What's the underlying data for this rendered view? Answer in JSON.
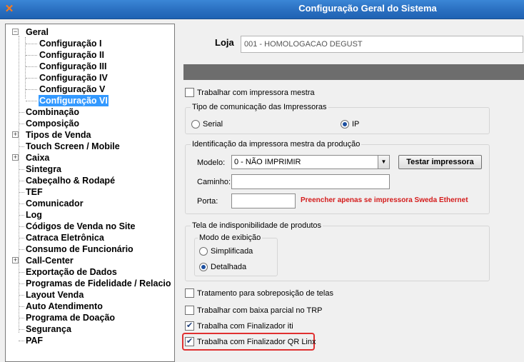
{
  "window": {
    "title": "Configuração Geral do Sistema",
    "icon": "x-logo-icon",
    "accent": "#2a6fc0"
  },
  "tree": {
    "items": [
      {
        "label": "Geral",
        "expanded": true
      },
      {
        "label": "Configuração I"
      },
      {
        "label": "Configuração II"
      },
      {
        "label": "Configuração III"
      },
      {
        "label": "Configuração IV"
      },
      {
        "label": "Configuração V"
      },
      {
        "label": "Configuração VI",
        "selected": true
      },
      {
        "label": "Combinação"
      },
      {
        "label": "Composição"
      },
      {
        "label": "Tipos de Venda",
        "expandable": true
      },
      {
        "label": "Touch Screen / Mobile"
      },
      {
        "label": "Caixa",
        "expandable": true
      },
      {
        "label": "Sintegra"
      },
      {
        "label": "Cabeçalho & Rodapé"
      },
      {
        "label": "TEF"
      },
      {
        "label": "Comunicador"
      },
      {
        "label": "Log"
      },
      {
        "label": "Códigos de Venda no Site"
      },
      {
        "label": "Catraca Eletrônica"
      },
      {
        "label": "Consumo de Funcionário"
      },
      {
        "label": "Call-Center",
        "expandable": true
      },
      {
        "label": "Exportação de Dados"
      },
      {
        "label": "Programas de Fidelidade / Relacio"
      },
      {
        "label": "Layout Venda"
      },
      {
        "label": "Auto Atendimento"
      },
      {
        "label": "Programa de Doação"
      },
      {
        "label": "Segurança"
      },
      {
        "label": "PAF"
      }
    ]
  },
  "loja": {
    "label": "Loja",
    "value": "001 - HOMOLOGACAO DEGUST"
  },
  "options": {
    "impressora_mestra": {
      "label": "Trabalhar com impressora mestra",
      "checked": false
    },
    "sobreposicao": {
      "label": "Tratamento para sobreposição de telas",
      "checked": false
    },
    "baixa_parcial": {
      "label": "Trabalhar com baixa parcial no TRP",
      "checked": false
    },
    "finalizador_iti": {
      "label": "Trabalha com Finalizador iti",
      "checked": true
    },
    "finalizador_qr": {
      "label": "Trabalha com Finalizador QR Linx",
      "checked": true
    }
  },
  "comunicacao": {
    "title": "Tipo de comunicação das Impressoras",
    "serial_label": "Serial",
    "ip_label": "IP",
    "selected": "IP"
  },
  "identificacao": {
    "title": "Identificação da impressora mestra da produção",
    "modelo_label": "Modelo:",
    "modelo_value": "0 - NÃO IMPRIMIR",
    "testar_label": "Testar impressora",
    "caminho_label": "Caminho:",
    "porta_label": "Porta:",
    "porta_hint": "Preencher apenas se impressora Sweda Ethernet"
  },
  "indisponibilidade": {
    "title": "Tela de indisponibilidade de produtos",
    "modo_title": "Modo de exibição",
    "simplificada_label": "Simplificada",
    "detalhada_label": "Detalhada",
    "selected": "Detalhada"
  },
  "colors": {
    "highlight": "#e03030",
    "warning": "#d41b1b",
    "selection": "#3399ff"
  }
}
